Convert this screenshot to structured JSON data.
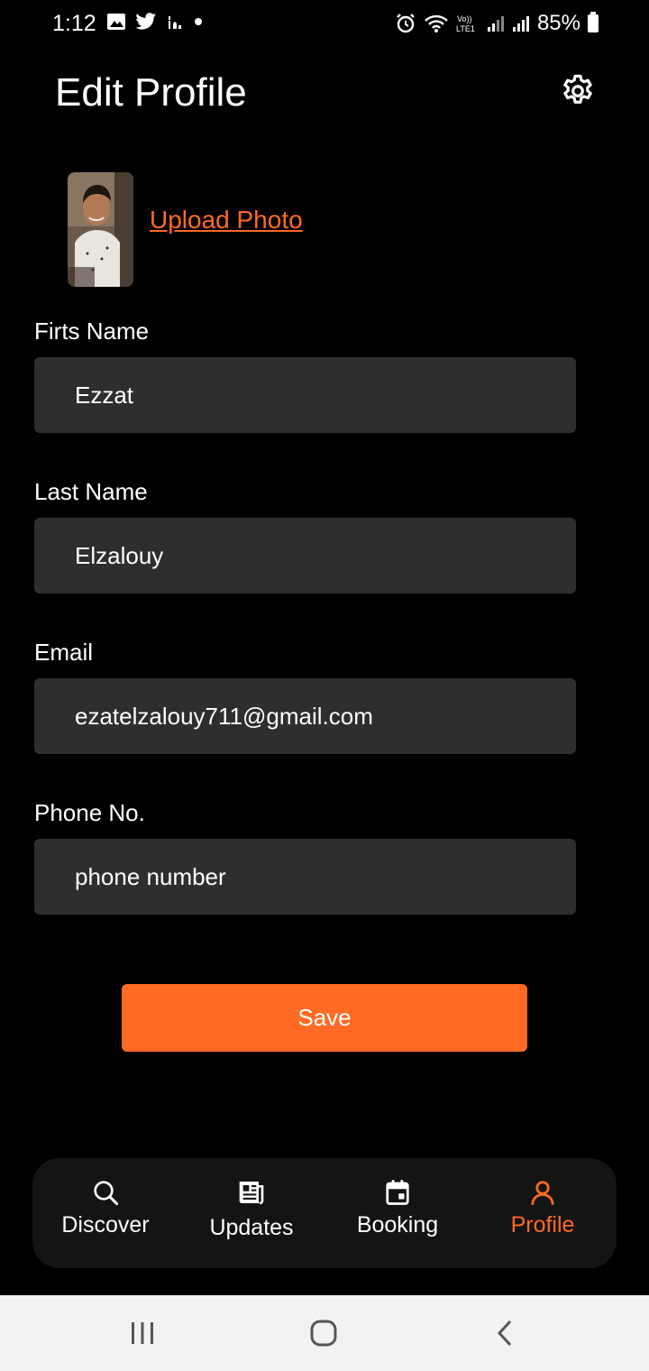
{
  "status_bar": {
    "time": "1:12",
    "battery": "85%",
    "left_icons": [
      "gallery-icon",
      "twitter-icon",
      "mosque-icon",
      "dot-icon"
    ],
    "right_icons": [
      "alarm-icon",
      "wifi-icon",
      "volte-icon",
      "signal-icon",
      "signal-icon",
      "battery-icon"
    ]
  },
  "header": {
    "title": "Edit Profile",
    "settings_icon": "gear-icon"
  },
  "profile": {
    "upload_label": "Upload Photo"
  },
  "form": {
    "first_name": {
      "label": "Firts Name",
      "value": "Ezzat"
    },
    "last_name": {
      "label": "Last Name",
      "value": "Elzalouy"
    },
    "email": {
      "label": "Email",
      "value": "ezatelzalouy711@gmail.com"
    },
    "phone": {
      "label": "Phone No.",
      "placeholder": "phone number"
    }
  },
  "actions": {
    "save_label": "Save"
  },
  "bottom_nav": {
    "items": [
      {
        "label": "Discover",
        "icon": "search-icon"
      },
      {
        "label": "Updates",
        "icon": "newspaper-icon"
      },
      {
        "label": "Booking",
        "icon": "calendar-icon"
      },
      {
        "label": "Profile",
        "icon": "user-icon"
      }
    ],
    "active": "Profile"
  },
  "colors": {
    "accent": "#ff6a24",
    "background": "#000000",
    "input_bg": "#2e2e2e",
    "nav_bg": "#141414"
  }
}
